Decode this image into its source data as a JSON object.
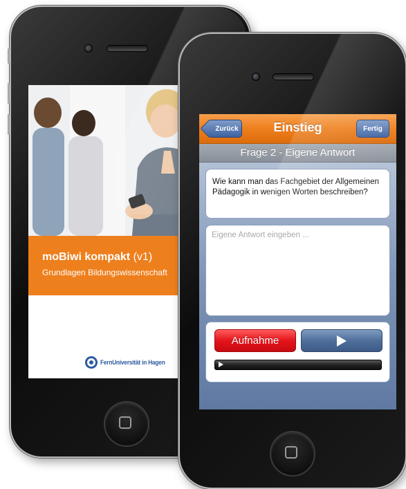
{
  "back_phone": {
    "app_title": "moBiwi kompakt",
    "app_version": "(v1)",
    "app_subtitle": "Grundlagen Bildungswissenschaft",
    "logo_text": "FernUniversität in Hagen",
    "colors": {
      "brand_orange": "#ee7f1d",
      "logo_blue": "#2c5aa0"
    }
  },
  "front_phone": {
    "navbar": {
      "back_label": "Zurück",
      "title": "Einstieg",
      "done_label": "Fertig"
    },
    "subheader": "Frage 2 - Eigene Antwort",
    "question": "Wie kann man das Fachgebiet der Allgemeinen Pädagogik in wenigen Worten beschreiben?",
    "answer": {
      "value": "",
      "placeholder": "Eigene Antwort eingeben ..."
    },
    "audio": {
      "record_label": "Aufnahme",
      "play_icon": "play-icon",
      "progress": 0
    },
    "colors": {
      "navbar_orange": "#ee7f1d",
      "button_blue": "#3e63a3",
      "record_red": "#e4141b"
    }
  }
}
